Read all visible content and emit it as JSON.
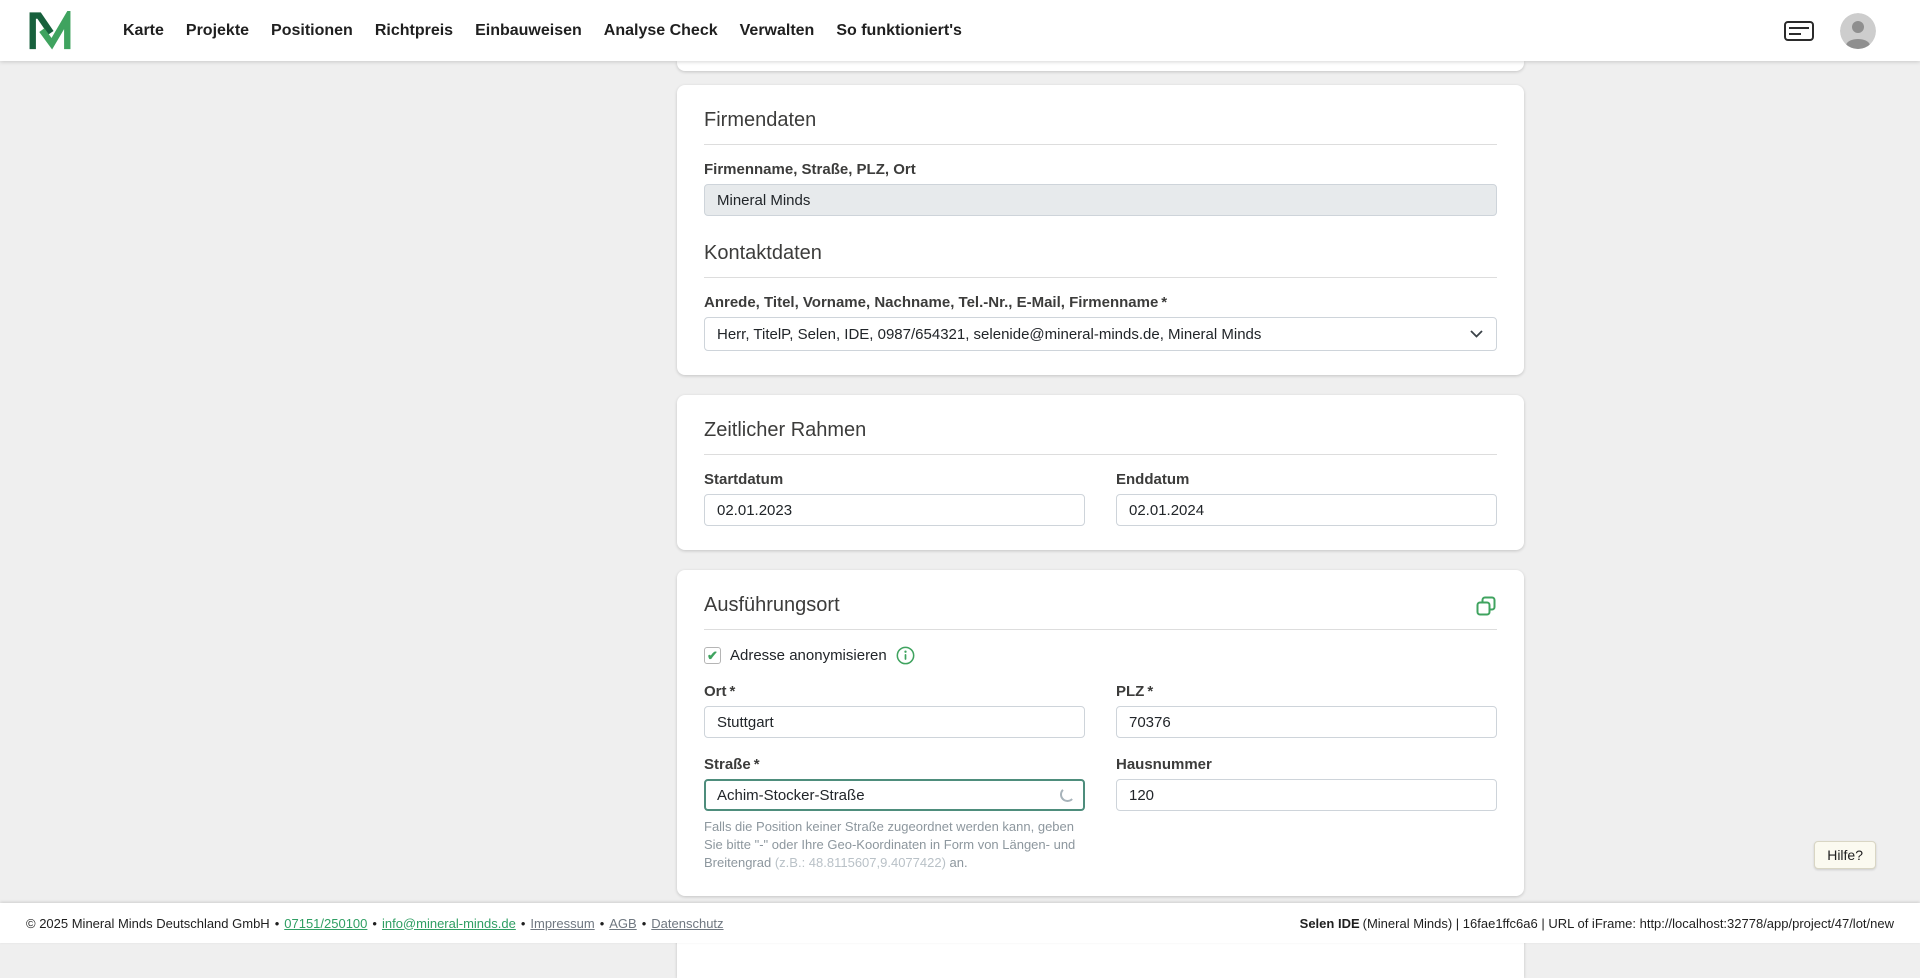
{
  "navbar": {
    "brand": "Mineral Minds",
    "items": [
      {
        "label": "Karte"
      },
      {
        "label": "Projekte"
      },
      {
        "label": "Positionen"
      },
      {
        "label": "Richtpreis"
      },
      {
        "label": "Einbauweisen"
      },
      {
        "label": "Analyse Check"
      },
      {
        "label": "Verwalten"
      },
      {
        "label": "So funktioniert's"
      }
    ]
  },
  "colors": {
    "accent_green": "#3fa35f",
    "focus_border": "#4e8d7c"
  },
  "icons": {
    "checkbox_check": "✔"
  },
  "required_mark": "*",
  "sections": {
    "firmendaten": {
      "title": "Firmendaten",
      "firmenname_label": "Firmenname, Straße, PLZ, Ort",
      "firmenname_value": "Mineral Minds",
      "kontaktdaten_title": "Kontaktdaten",
      "kontakt_label": "Anrede, Titel, Vorname, Nachname, Tel.-Nr., E-Mail, Firmenname",
      "kontakt_value": "Herr, TitelP, Selen, IDE, 0987/654321, selenide@mineral-minds.de, Mineral Minds"
    },
    "zeitraum": {
      "title": "Zeitlicher Rahmen",
      "start_label": "Startdatum",
      "start_value": "02.01.2023",
      "end_label": "Enddatum",
      "end_value": "02.01.2024"
    },
    "ausfuehrungsort": {
      "title": "Ausführungsort",
      "anonymize_label": "Adresse anonymisieren",
      "ort_label": "Ort",
      "ort_value": "Stuttgart",
      "plz_label": "PLZ",
      "plz_value": "70376",
      "strasse_label": "Straße",
      "strasse_value": "Achim-Stocker-Straße",
      "hausnummer_label": "Hausnummer",
      "hausnummer_value": "120",
      "hint_text": "Falls die Position keiner Straße zugeordnet werden kann, geben Sie bitte \"-\" oder Ihre Geo-Koordinaten in Form von Längen- und Breitengrad",
      "hint_example": "(z.B.: 48.8115607,9.4077422)",
      "hint_suffix": "an."
    }
  },
  "help_button": "Hilfe?",
  "footer": {
    "copyright": "© 2025 Mineral Minds Deutschland GmbH",
    "sep": "•",
    "phone": "07151/250100",
    "email": "info@mineral-minds.de",
    "link_impressum": "Impressum",
    "link_agb": "AGB",
    "link_datenschutz": "Datenschutz",
    "env_bold": "Selen IDE",
    "env_text": "(Mineral Minds) | 16fae1ffc6a6 | URL of iFrame: http://localhost:32778/app/project/47/lot/new"
  }
}
